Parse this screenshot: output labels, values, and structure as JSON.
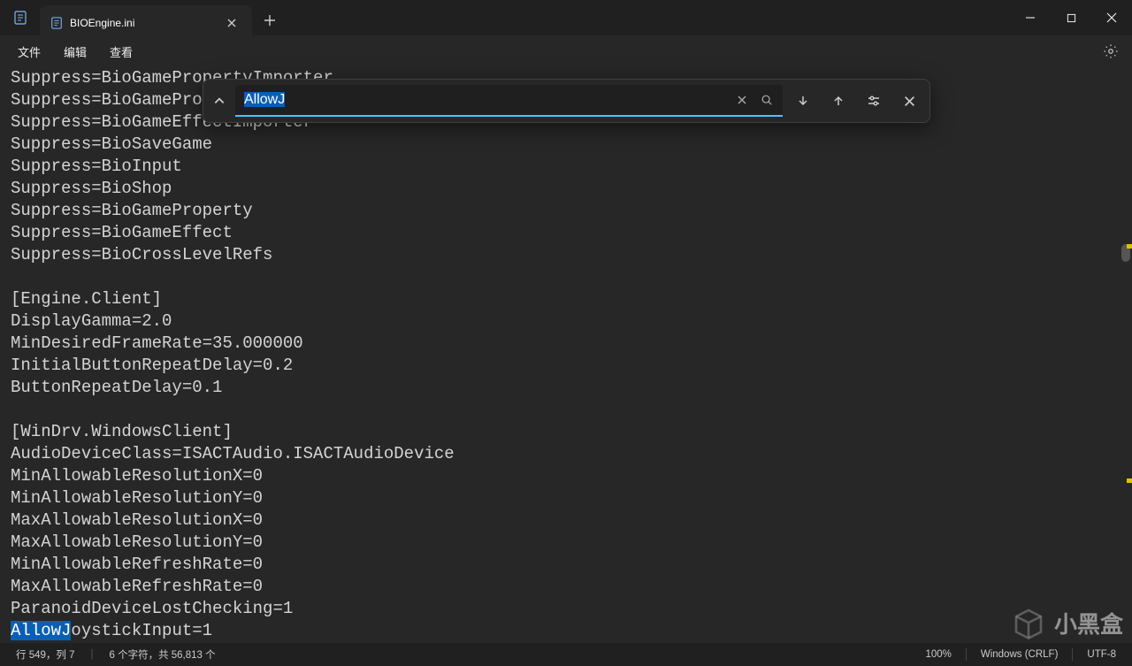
{
  "tab": {
    "title": "BIOEngine.ini"
  },
  "menus": {
    "file": "文件",
    "edit": "编辑",
    "view": "查看"
  },
  "find": {
    "value": "AllowJ"
  },
  "lines": [
    "Suppress=BioGamePropertyImporter",
    "Suppress=BioGameProperty",
    "Suppress=BioGameEffectImporter",
    "Suppress=BioSaveGame",
    "Suppress=BioInput",
    "Suppress=BioShop",
    "Suppress=BioGameProperty",
    "Suppress=BioGameEffect",
    "Suppress=BioCrossLevelRefs",
    "",
    "[Engine.Client]",
    "DisplayGamma=2.0",
    "MinDesiredFrameRate=35.000000",
    "InitialButtonRepeatDelay=0.2",
    "ButtonRepeatDelay=0.1",
    "",
    "[WinDrv.WindowsClient]",
    "AudioDeviceClass=ISACTAudio.ISACTAudioDevice",
    "MinAllowableResolutionX=0",
    "MinAllowableResolutionY=0",
    "MaxAllowableResolutionX=0",
    "MaxAllowableResolutionY=0",
    "MinAllowableRefreshRate=0",
    "MaxAllowableRefreshRate=0",
    "ParanoidDeviceLostChecking=1",
    "AllowJoystickInput=1"
  ],
  "status": {
    "pos": "行 549，列 7",
    "sel": "6 个字符，共 56,813 个",
    "zoom": "100%",
    "eol": "Windows (CRLF)",
    "encoding": "UTF-8"
  },
  "watermark": "小黑盒"
}
